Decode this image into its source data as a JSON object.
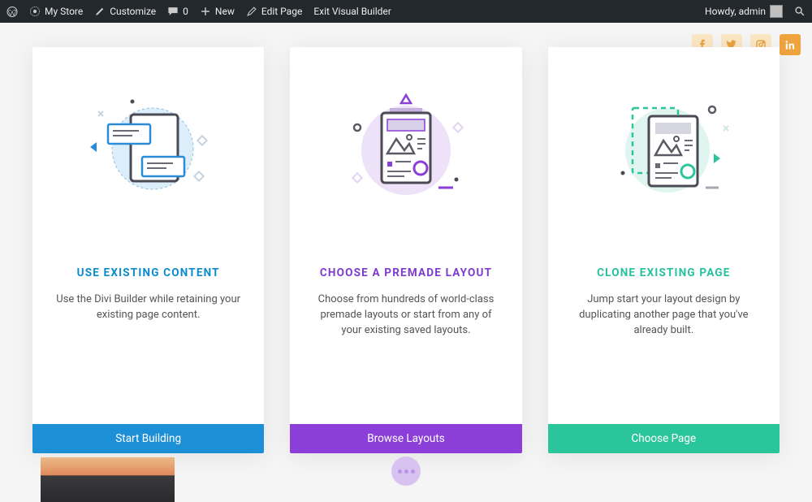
{
  "adminbar": {
    "site_name": "My Store",
    "customize": "Customize",
    "comments_count": "0",
    "new": "New",
    "edit_page": "Edit Page",
    "exit_vb": "Exit Visual Builder",
    "greeting": "Howdy, admin"
  },
  "cards": [
    {
      "title": "USE EXISTING CONTENT",
      "desc": "Use the Divi Builder while retaining your existing page content.",
      "button": "Start Building",
      "accent": "blue"
    },
    {
      "title": "CHOOSE A PREMADE LAYOUT",
      "desc": "Choose from hundreds of world-class premade layouts or start from any of your existing saved layouts.",
      "button": "Browse Layouts",
      "accent": "purple"
    },
    {
      "title": "CLONE EXISTING PAGE",
      "desc": "Jump start your layout design by duplicating another page that you've already built.",
      "button": "Choose Page",
      "accent": "teal"
    }
  ]
}
